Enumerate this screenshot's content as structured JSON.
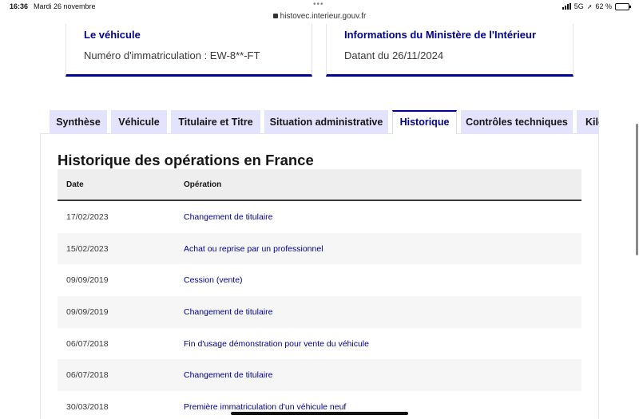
{
  "status_bar": {
    "time": "16:36",
    "date": "Mardi 26 novembre",
    "url": "histovec.interieur.gouv.fr",
    "network": "5G",
    "battery": "62 %",
    "battery_level": 0.62
  },
  "cards": [
    {
      "title": "Le véhicule",
      "text": "Numéro d'immatriculation : EW-8**-FT"
    },
    {
      "title": "Informations du Ministère de l'Intérieur",
      "text": "Datant du 26/11/2024"
    }
  ],
  "tabs": [
    {
      "label": "Synthèse"
    },
    {
      "label": "Véhicule"
    },
    {
      "label": "Titulaire et Titre"
    },
    {
      "label": "Situation administrative"
    },
    {
      "label": "Historique"
    },
    {
      "label": "Contrôles techniques"
    },
    {
      "label": "Kilométrage"
    }
  ],
  "active_tab": "Historique",
  "section_title": "Historique des opérations en France",
  "table": {
    "headers": [
      "Date",
      "Opération"
    ],
    "rows": [
      {
        "date": "17/02/2023",
        "operation": "Changement de titulaire"
      },
      {
        "date": "15/02/2023",
        "operation": "Achat ou reprise par un professionnel"
      },
      {
        "date": "09/09/2019",
        "operation": "Cession (vente)"
      },
      {
        "date": "09/09/2019",
        "operation": "Changement de titulaire"
      },
      {
        "date": "06/07/2018",
        "operation": "Fin d'usage démonstration pour vente du véhicule"
      },
      {
        "date": "06/07/2018",
        "operation": "Changement de titulaire"
      },
      {
        "date": "30/03/2018",
        "operation": "Première immatriculation d'un véhicule neuf"
      }
    ]
  },
  "colors": {
    "accent": "#000091",
    "tab_bg": "#e3e3fd",
    "header_bg": "#eeeeee"
  }
}
